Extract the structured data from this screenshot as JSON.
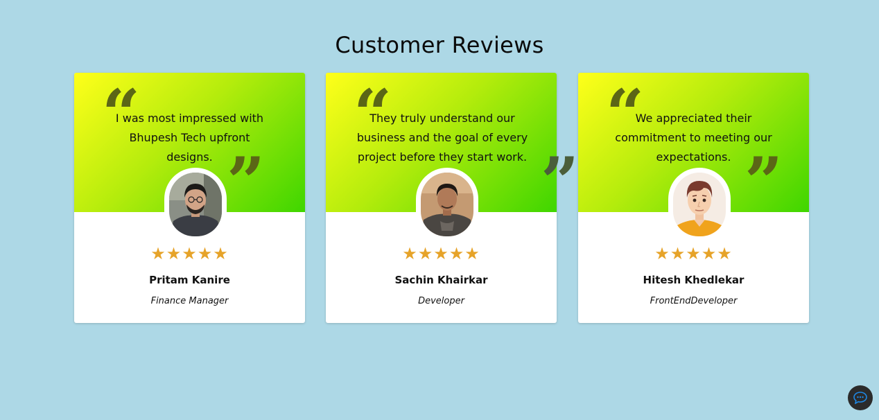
{
  "section": {
    "title": "Customer Reviews"
  },
  "reviews": [
    {
      "quote": "I was most impressed with Bhupesh Tech upfront designs.",
      "name": "Pritam Kanire",
      "role": "Finance Manager",
      "rating": 5,
      "stars": "★★★★★"
    },
    {
      "quote": "They truly understand our business and the goal of every project before they start work.",
      "name": "Sachin Khairkar",
      "role": "Developer",
      "rating": 5,
      "stars": "★★★★★"
    },
    {
      "quote": "We appreciated their commitment to meeting our expectations.",
      "name": "Hitesh Khedlekar",
      "role": "FrontEndDeveloper",
      "rating": 5,
      "stars": "★★★★★"
    }
  ],
  "icons": {
    "quote_open": "“",
    "quote_close": "”",
    "chat": "chat-bubble-icon"
  },
  "colors": {
    "background": "#add8e6",
    "gradient_start": "#ffff1a",
    "gradient_end": "#3fd600",
    "star": "#e6a329",
    "chat_button": "#2b2b2b",
    "chat_icon": "#1e88e5"
  }
}
